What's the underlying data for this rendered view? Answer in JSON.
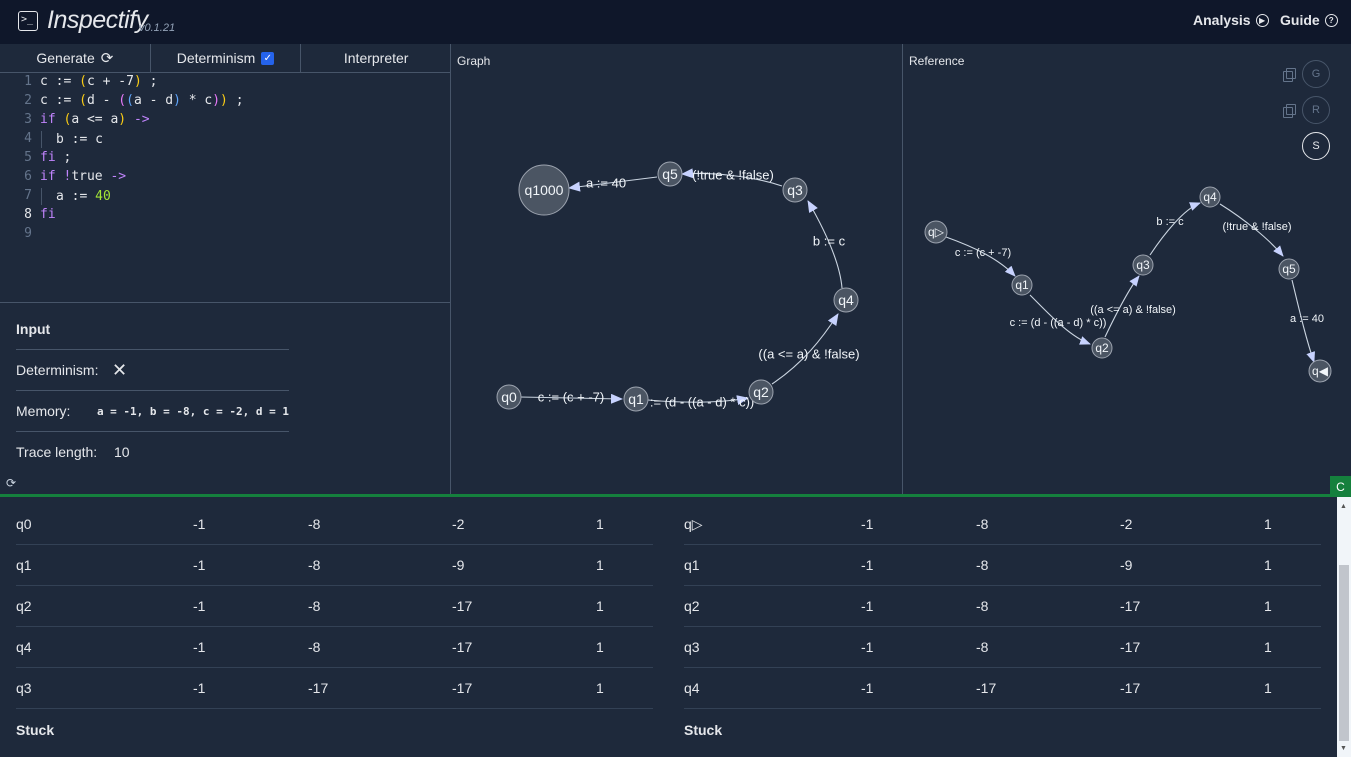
{
  "header": {
    "title": "Inspectify",
    "version": "v0.1.21",
    "analysis_label": "Analysis",
    "guide_label": "Guide"
  },
  "tabs": {
    "generate": "Generate",
    "determinism": "Determinism",
    "interpreter": "Interpreter"
  },
  "editor": {
    "line_numbers": [
      "1",
      "2",
      "3",
      "4",
      "5",
      "6",
      "7",
      "8",
      "9"
    ]
  },
  "input": {
    "title": "Input",
    "determinism_label": "Determinism:",
    "memory_label": "Memory:",
    "memory_value": "a = -1, b = -8, c = -2, d = 1",
    "trace_length_label": "Trace length:",
    "trace_length_value": "10"
  },
  "graph": {
    "label": "Graph",
    "nodes": [
      "q0",
      "q1",
      "q2",
      "q4",
      "q3",
      "q5",
      "q1000"
    ],
    "edges": [
      "c := (c + -7)",
      "c := (d - ((a - d) * c))",
      "((a <= a) & !false)",
      "b := c",
      "(!true & !false)",
      "a := 40"
    ]
  },
  "reference": {
    "label": "Reference",
    "nodes": [
      "q▷",
      "q1",
      "q2",
      "q3",
      "q4",
      "q5",
      "q◀"
    ],
    "edges": [
      "c := (c + -7)",
      "c := (d - ((a - d) * c))",
      "((a <= a) & !false)",
      "b := c",
      "(!true & !false)",
      "a := 40"
    ],
    "buttons": [
      "G",
      "R",
      "S"
    ]
  },
  "divider_button": "C",
  "trace_left": {
    "rows": [
      [
        "q0",
        "-1",
        "-8",
        "-2",
        "1"
      ],
      [
        "q1",
        "-1",
        "-8",
        "-9",
        "1"
      ],
      [
        "q2",
        "-1",
        "-8",
        "-17",
        "1"
      ],
      [
        "q4",
        "-1",
        "-8",
        "-17",
        "1"
      ],
      [
        "q3",
        "-1",
        "-17",
        "-17",
        "1"
      ]
    ],
    "status": "Stuck"
  },
  "trace_right": {
    "rows": [
      [
        "q▷",
        "-1",
        "-8",
        "-2",
        "1"
      ],
      [
        "q1",
        "-1",
        "-8",
        "-9",
        "1"
      ],
      [
        "q2",
        "-1",
        "-8",
        "-17",
        "1"
      ],
      [
        "q3",
        "-1",
        "-8",
        "-17",
        "1"
      ],
      [
        "q4",
        "-1",
        "-17",
        "-17",
        "1"
      ]
    ],
    "status": "Stuck"
  },
  "colors": {
    "background": "#1e293b",
    "header": "#0f172a",
    "accent_green": "#15803d",
    "checkbox_blue": "#2563eb"
  }
}
